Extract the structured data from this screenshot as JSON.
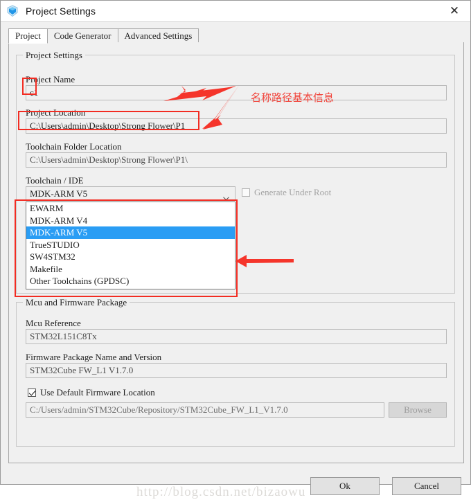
{
  "window": {
    "title": "Project Settings",
    "icon": "cube-shield-icon",
    "close_label": "✕"
  },
  "tabs": [
    {
      "label": "Project",
      "active": true
    },
    {
      "label": "Code Generator",
      "active": false
    },
    {
      "label": "Advanced Settings",
      "active": false
    }
  ],
  "project_group": {
    "title": "Project Settings",
    "project_name": {
      "label": "Project Name",
      "value": "c1"
    },
    "project_location": {
      "label": "Project Location",
      "value": "C:\\Users\\admin\\Desktop\\Strong Flower\\P1"
    },
    "toolchain_folder_location": {
      "label": "Toolchain Folder Location",
      "value": "C:\\Users\\admin\\Desktop\\Strong Flower\\P1\\"
    },
    "toolchain_ide": {
      "label": "Toolchain / IDE",
      "selected": "MDK-ARM V5",
      "options": [
        "EWARM",
        "MDK-ARM V4",
        "MDK-ARM V5",
        "TrueSTUDIO",
        "SW4STM32",
        "Makefile",
        "Other Toolchains (GPDSC)"
      ],
      "selected_index": 2,
      "expanded": true
    },
    "generate_under_root": {
      "label": "Generate Under Root",
      "checked": false,
      "disabled": true
    }
  },
  "mcu_group": {
    "title": "Mcu and Firmware Package",
    "mcu_reference": {
      "label": "Mcu Reference",
      "value": "STM32L151C8Tx"
    },
    "firmware_package": {
      "label": "Firmware Package Name and Version",
      "value": "STM32Cube FW_L1 V1.7.0"
    },
    "use_default_firmware_location": {
      "label": "Use Default Firmware Location",
      "checked": true
    },
    "firmware_path": {
      "value": "C:/Users/admin/STM32Cube/Repository/STM32Cube_FW_L1_V1.7.0"
    },
    "browse_button": {
      "label": "Browse",
      "disabled": true
    }
  },
  "footer": {
    "ok_label": "Ok",
    "cancel_label": "Cancel"
  },
  "annotations": {
    "chinese_note": "名称路径基本信息",
    "accent_color": "#f22c22"
  },
  "watermark": {
    "text": "http://blog.csdn.net/bizaowu"
  }
}
